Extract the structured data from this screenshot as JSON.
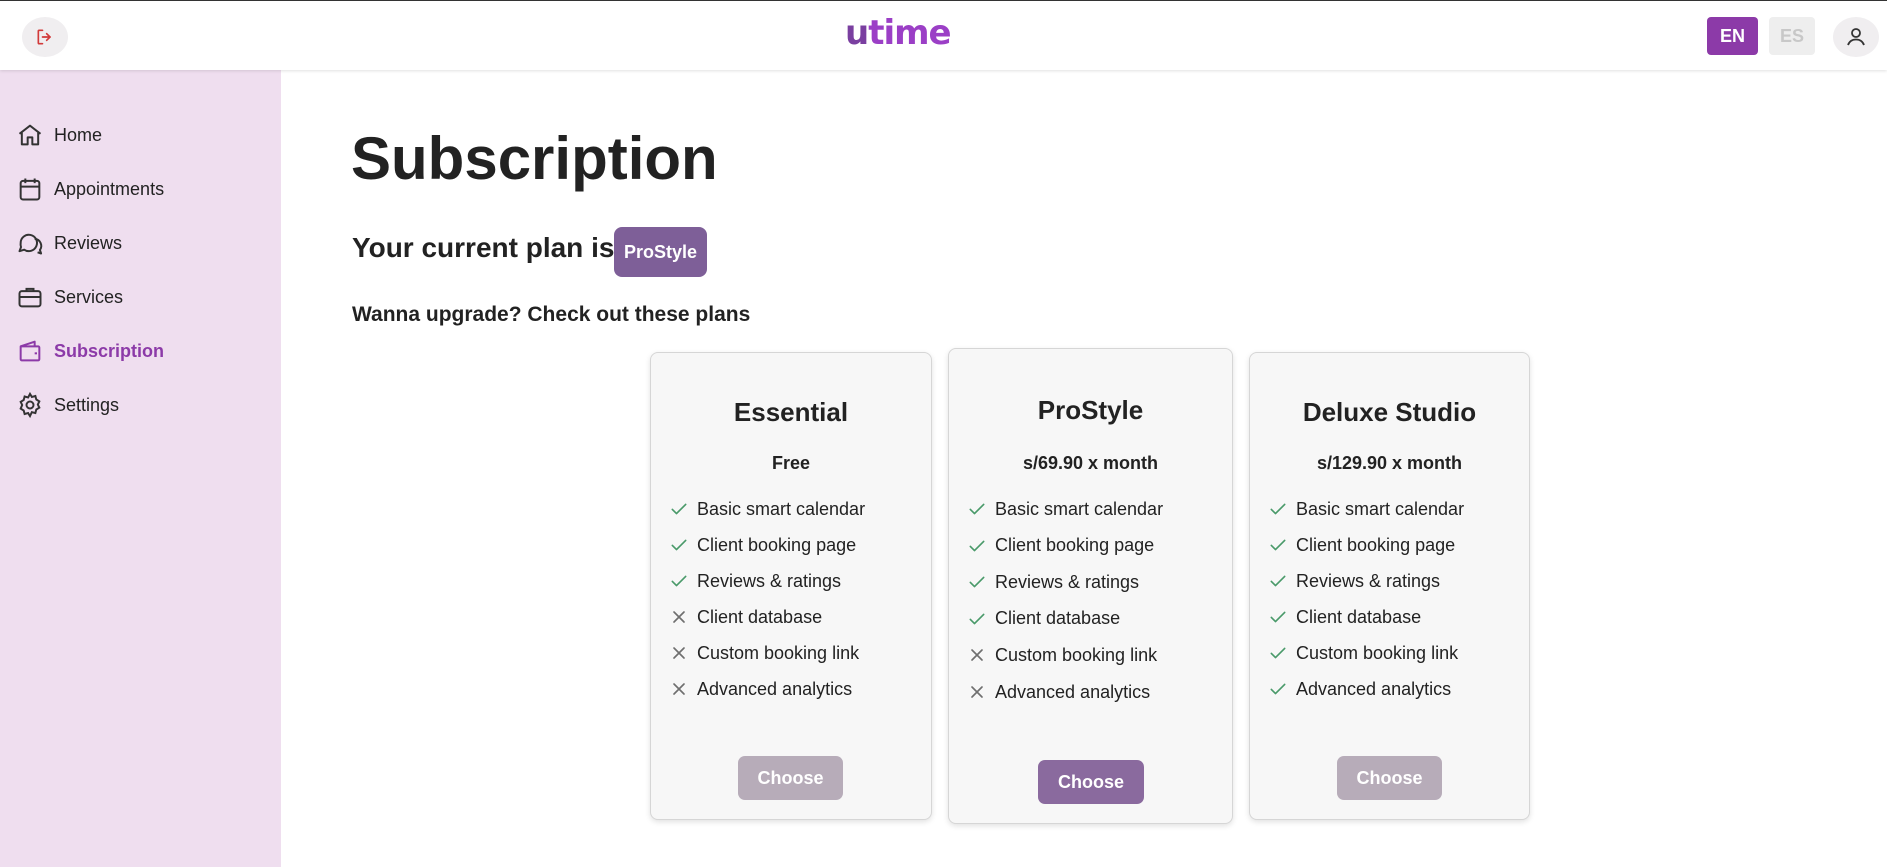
{
  "header": {
    "logo": {
      "prefix": "u",
      "accent": "time"
    },
    "lang": {
      "en": "EN",
      "es": "ES"
    }
  },
  "sidebar": {
    "items": [
      {
        "label": "Home",
        "icon": "home-icon",
        "active": false
      },
      {
        "label": "Appointments",
        "icon": "calendar-icon",
        "active": false
      },
      {
        "label": "Reviews",
        "icon": "chat-icon",
        "active": false
      },
      {
        "label": "Services",
        "icon": "briefcase-icon",
        "active": false
      },
      {
        "label": "Subscription",
        "icon": "wallet-icon",
        "active": true
      },
      {
        "label": "Settings",
        "icon": "gear-icon",
        "active": false
      }
    ]
  },
  "main": {
    "title": "Subscription",
    "current_plan_label": "Your current plan is:",
    "current_plan": "ProStyle",
    "upgrade_text": "Wanna upgrade? Check out these plans"
  },
  "plans": [
    {
      "name": "Essential",
      "price": "Free",
      "choose_label": "Choose",
      "features": [
        {
          "label": "Basic smart calendar",
          "included": true
        },
        {
          "label": "Client booking page",
          "included": true
        },
        {
          "label": "Reviews & ratings",
          "included": true
        },
        {
          "label": "Client database",
          "included": false
        },
        {
          "label": "Custom booking link",
          "included": false
        },
        {
          "label": "Advanced analytics",
          "included": false
        }
      ]
    },
    {
      "name": "ProStyle",
      "price": "s/69.90 x month",
      "choose_label": "Choose",
      "features": [
        {
          "label": "Basic smart calendar",
          "included": true
        },
        {
          "label": "Client booking page",
          "included": true
        },
        {
          "label": "Reviews & ratings",
          "included": true
        },
        {
          "label": "Client database",
          "included": true
        },
        {
          "label": "Custom booking link",
          "included": false
        },
        {
          "label": "Advanced analytics",
          "included": false
        }
      ]
    },
    {
      "name": "Deluxe Studio",
      "price": "s/129.90 x month",
      "choose_label": "Choose",
      "features": [
        {
          "label": "Basic smart calendar",
          "included": true
        },
        {
          "label": "Client booking page",
          "included": true
        },
        {
          "label": "Reviews & ratings",
          "included": true
        },
        {
          "label": "Client database",
          "included": true
        },
        {
          "label": "Custom booking link",
          "included": true
        },
        {
          "label": "Advanced analytics",
          "included": true
        }
      ]
    }
  ],
  "colors": {
    "accent": "#8c3aa8",
    "sidebar_bg": "#efdeef",
    "check": "#4a9a6a",
    "cross": "#6f6f6f"
  }
}
